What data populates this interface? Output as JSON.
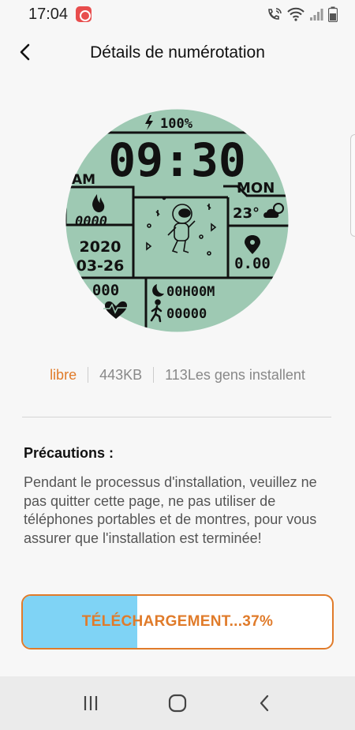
{
  "status_bar": {
    "time": "17:04"
  },
  "header": {
    "title": "Détails de numérotation"
  },
  "watch_face": {
    "battery": "100%",
    "time": "09:30",
    "ampm": "AM",
    "day": "MON",
    "calories": "0000",
    "temperature": "23°",
    "year": "2020",
    "date": "03-26",
    "distance": "0.00",
    "heart_rate": "000",
    "sleep": "00H00M",
    "steps": "00000",
    "background_color": "#9ec9b3"
  },
  "meta": {
    "price": "libre",
    "size": "443KB",
    "installs": "113Les gens installent"
  },
  "precautions": {
    "title": "Précautions :",
    "text": "Pendant le processus d'installation, veuillez ne pas quitter cette page, ne pas utiliser de téléphones portables et de montres, pour vous assurer que l'installation est terminée!"
  },
  "download": {
    "label": "TÉLÉCHARGEMENT...37%",
    "progress": 0.37,
    "accent_color": "#e07b2a",
    "fill_color": "#7fd3f5"
  },
  "nav": {
    "recents_icon": "recents-icon",
    "home_icon": "home-icon",
    "back_icon": "back-icon"
  }
}
